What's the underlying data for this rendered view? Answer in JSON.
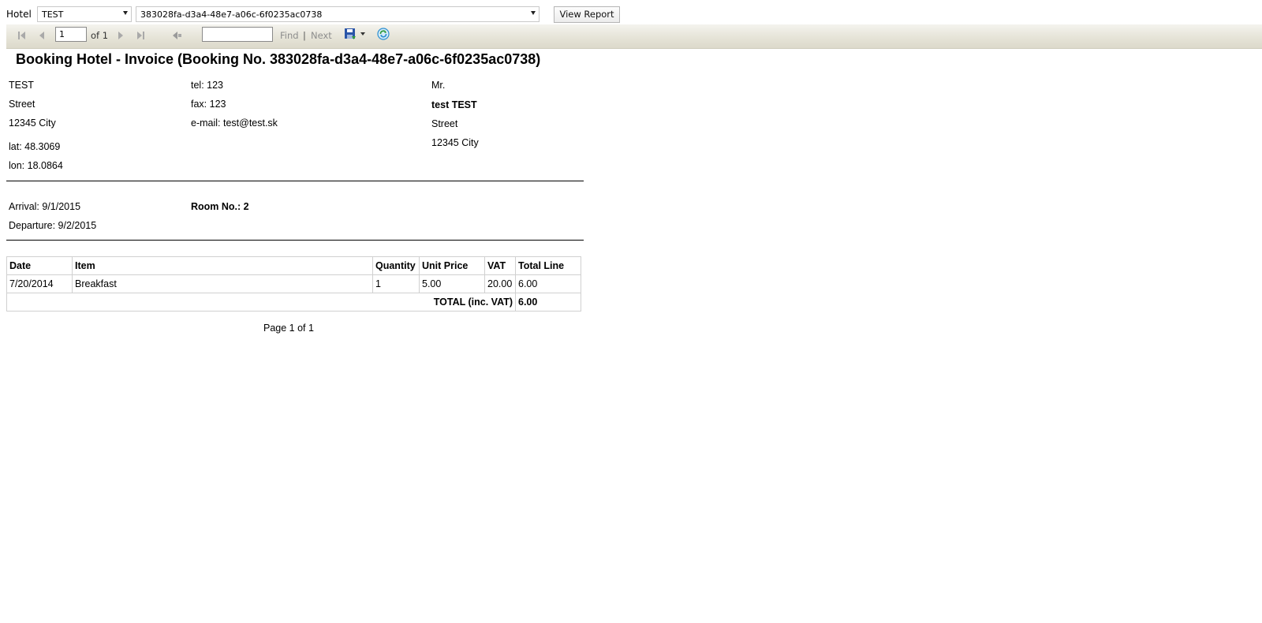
{
  "params": {
    "hotel_label": "Hotel",
    "hotel_value": "TEST",
    "booking_value": "383028fa-d3a4-48e7-a06c-6f0235ac0738",
    "view_report_label": "View Report"
  },
  "toolbar": {
    "page_value": "1",
    "of_text": "of 1",
    "find_label": "Find",
    "separator": "|",
    "next_label": "Next",
    "find_value": ""
  },
  "icons": {
    "first_page": "first-page-icon",
    "prev_page": "previous-page-icon",
    "next_page": "next-page-icon",
    "last_page": "last-page-icon",
    "back": "back-to-parent-icon",
    "export": "save-export-icon",
    "refresh": "refresh-icon"
  },
  "report": {
    "title": "Booking Hotel - Invoice (Booking No. 383028fa-d3a4-48e7-a06c-6f0235ac0738)",
    "hotel": {
      "name": "TEST",
      "street": "Street",
      "city": "12345 City",
      "lat": "lat: 48.3069",
      "lon": "lon: 18.0864",
      "tel": "tel: 123",
      "fax": "fax: 123",
      "email": "e-mail: test@test.sk"
    },
    "guest": {
      "salutation": "Mr.",
      "name": "test TEST",
      "street": "Street",
      "city": "12345 City"
    },
    "stay": {
      "arrival": "Arrival: 9/1/2015",
      "departure": "Departure: 9/2/2015",
      "room": "Room No.: 2"
    },
    "table": {
      "headers": [
        "Date",
        "Item",
        "Quantity",
        "Unit Price",
        "VAT",
        "Total Line"
      ],
      "rows": [
        [
          "7/20/2014",
          "Breakfast",
          "1",
          "5.00",
          "20.00",
          "6.00"
        ]
      ],
      "total_label": "TOTAL (inc. VAT)",
      "total_value": "6.00"
    },
    "footer": "Page 1 of 1"
  },
  "colors": {
    "toolbar_top": "#f4f3ee",
    "toolbar_bottom": "#dcd9cb",
    "link_gray": "#8d8d8d",
    "save_blue": "#2a55a8",
    "refresh_blue": "#2c8fd0"
  }
}
